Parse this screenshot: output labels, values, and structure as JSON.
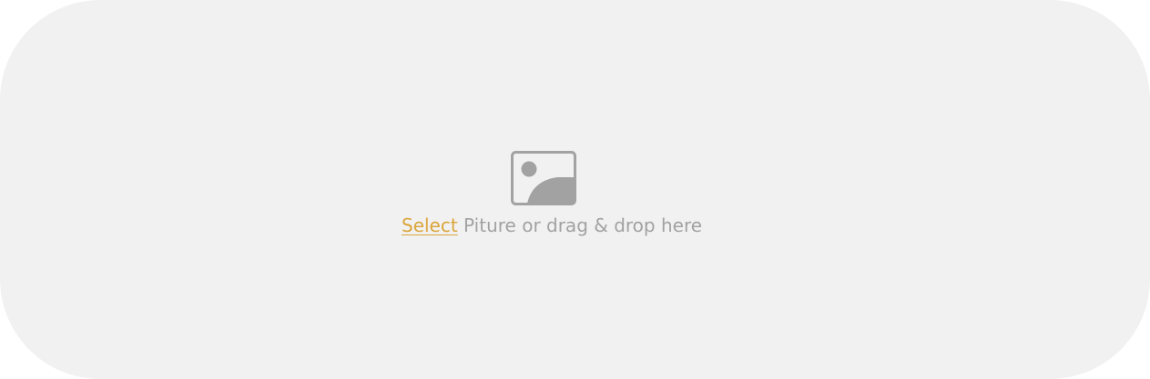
{
  "upload": {
    "icon": "image-placeholder-icon",
    "select_label": "Select",
    "rest_label": " Piture or drag & drop here"
  },
  "colors": {
    "background": "#f1f1f1",
    "icon": "#a2a2a2",
    "accent": "#dba53a",
    "text": "#a2a2a2"
  }
}
